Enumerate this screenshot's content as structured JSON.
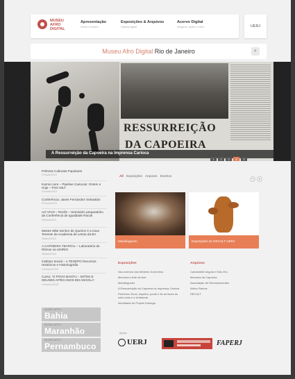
{
  "header": {
    "logo_lines": [
      "MUSEU",
      "AFRO",
      "DIGITAL"
    ],
    "nav": [
      {
        "title": "Apresentação",
        "sub": "Sobre o Museu"
      },
      {
        "title": "Exposições & Arquivos",
        "sub": "Galeria digital"
      },
      {
        "title": "Acervo Digital",
        "sub": "Imagens, áudio e vídeo"
      }
    ],
    "uerj": "UERJ"
  },
  "title": {
    "part1": "Museu Afro Digital",
    "part2": " Rio de Janeiro"
  },
  "search_icon": "magnifier-icon",
  "banner": {
    "headline_line1": "RESSURREIÇÃO",
    "headline_line2": "DA CAPOEIRA",
    "caption": "A Ressurreição da Capoeira na Imprensa Carioca",
    "pager": [
      "1",
      "2",
      "3",
      "4",
      "5"
    ],
    "active_page": "4"
  },
  "sidebar": {
    "items": [
      {
        "title": "Prêmios Culturais Populares",
        "date": "07/maio/2015"
      },
      {
        "title": "Karnix Livre – Pipeline Cariocas: Ontem e Hoje – PGC-MLT",
        "date": "07/maio/2015"
      },
      {
        "title": "Conferência: Javier Fernández Sebastián",
        "date": "07/maio/2015"
      },
      {
        "title": "AO VIVO – Recife – Seminário preparatório da Conferência de Igualdade Racial",
        "date": "28/abril/2015"
      },
      {
        "title": "Mestre Mãe Senhor de Queiroz é a nova Tenente da Academia de Letras da BA",
        "date": "28/abril/2015"
      },
      {
        "title": "A CAPOEIRA TEATRAL – Laboratório de Ritmos na UNIRIO",
        "date": "28/abril/2015"
      },
      {
        "title": "Instituto Social – o TEGEPO Recursos Históricos e Historiografia",
        "date": "14/março/2015"
      },
      {
        "title": "Curso: 'O POVO BANTU – MITOS E DEUSES AFRICANOS EM ANGOLA'",
        "date": "14/março/2015"
      }
    ],
    "states": [
      {
        "label": "MUSEU AFRO",
        "name": "Bahia"
      },
      {
        "label": "MUSEU AFRO",
        "name": "Maranhão"
      },
      {
        "label": "MUSEU AFRO",
        "name": "Pernambuco"
      }
    ]
  },
  "filters": [
    "All",
    "Exposições",
    "Arquivos",
    "Eventos"
  ],
  "active_filter": "All",
  "social_icons": [
    "share-icon",
    "rss-icon"
  ],
  "cards": [
    {
      "caption": "Mandingueiro"
    },
    {
      "caption": "Exposições do DECULT-UERJ"
    }
  ],
  "columns": [
    {
      "heading": "Exposições",
      "items": [
        "Nos acervos dos Mestres Guerreiros",
        "Memória e Arte de Axé",
        "Mandingueiro",
        "A Ressurreição da Capoeira na Imprensa Carioca",
        "Performa: Ecos, espelho, ponte e fio as faces do culto ioiôs e a Umbanda",
        "Identidade do Projeto Kalunga"
      ]
    },
    {
      "heading": "Arquivos",
      "items": [
        "Candomblé Angola e Ketu Eru",
        "Memória da Capoeira",
        "Associação de Remanescentes",
        "Arthur Ramos",
        "DECULT"
      ]
    }
  ],
  "apoio": {
    "label": "Apoio:",
    "logos": [
      "UERJ",
      "FAPERJ"
    ]
  }
}
